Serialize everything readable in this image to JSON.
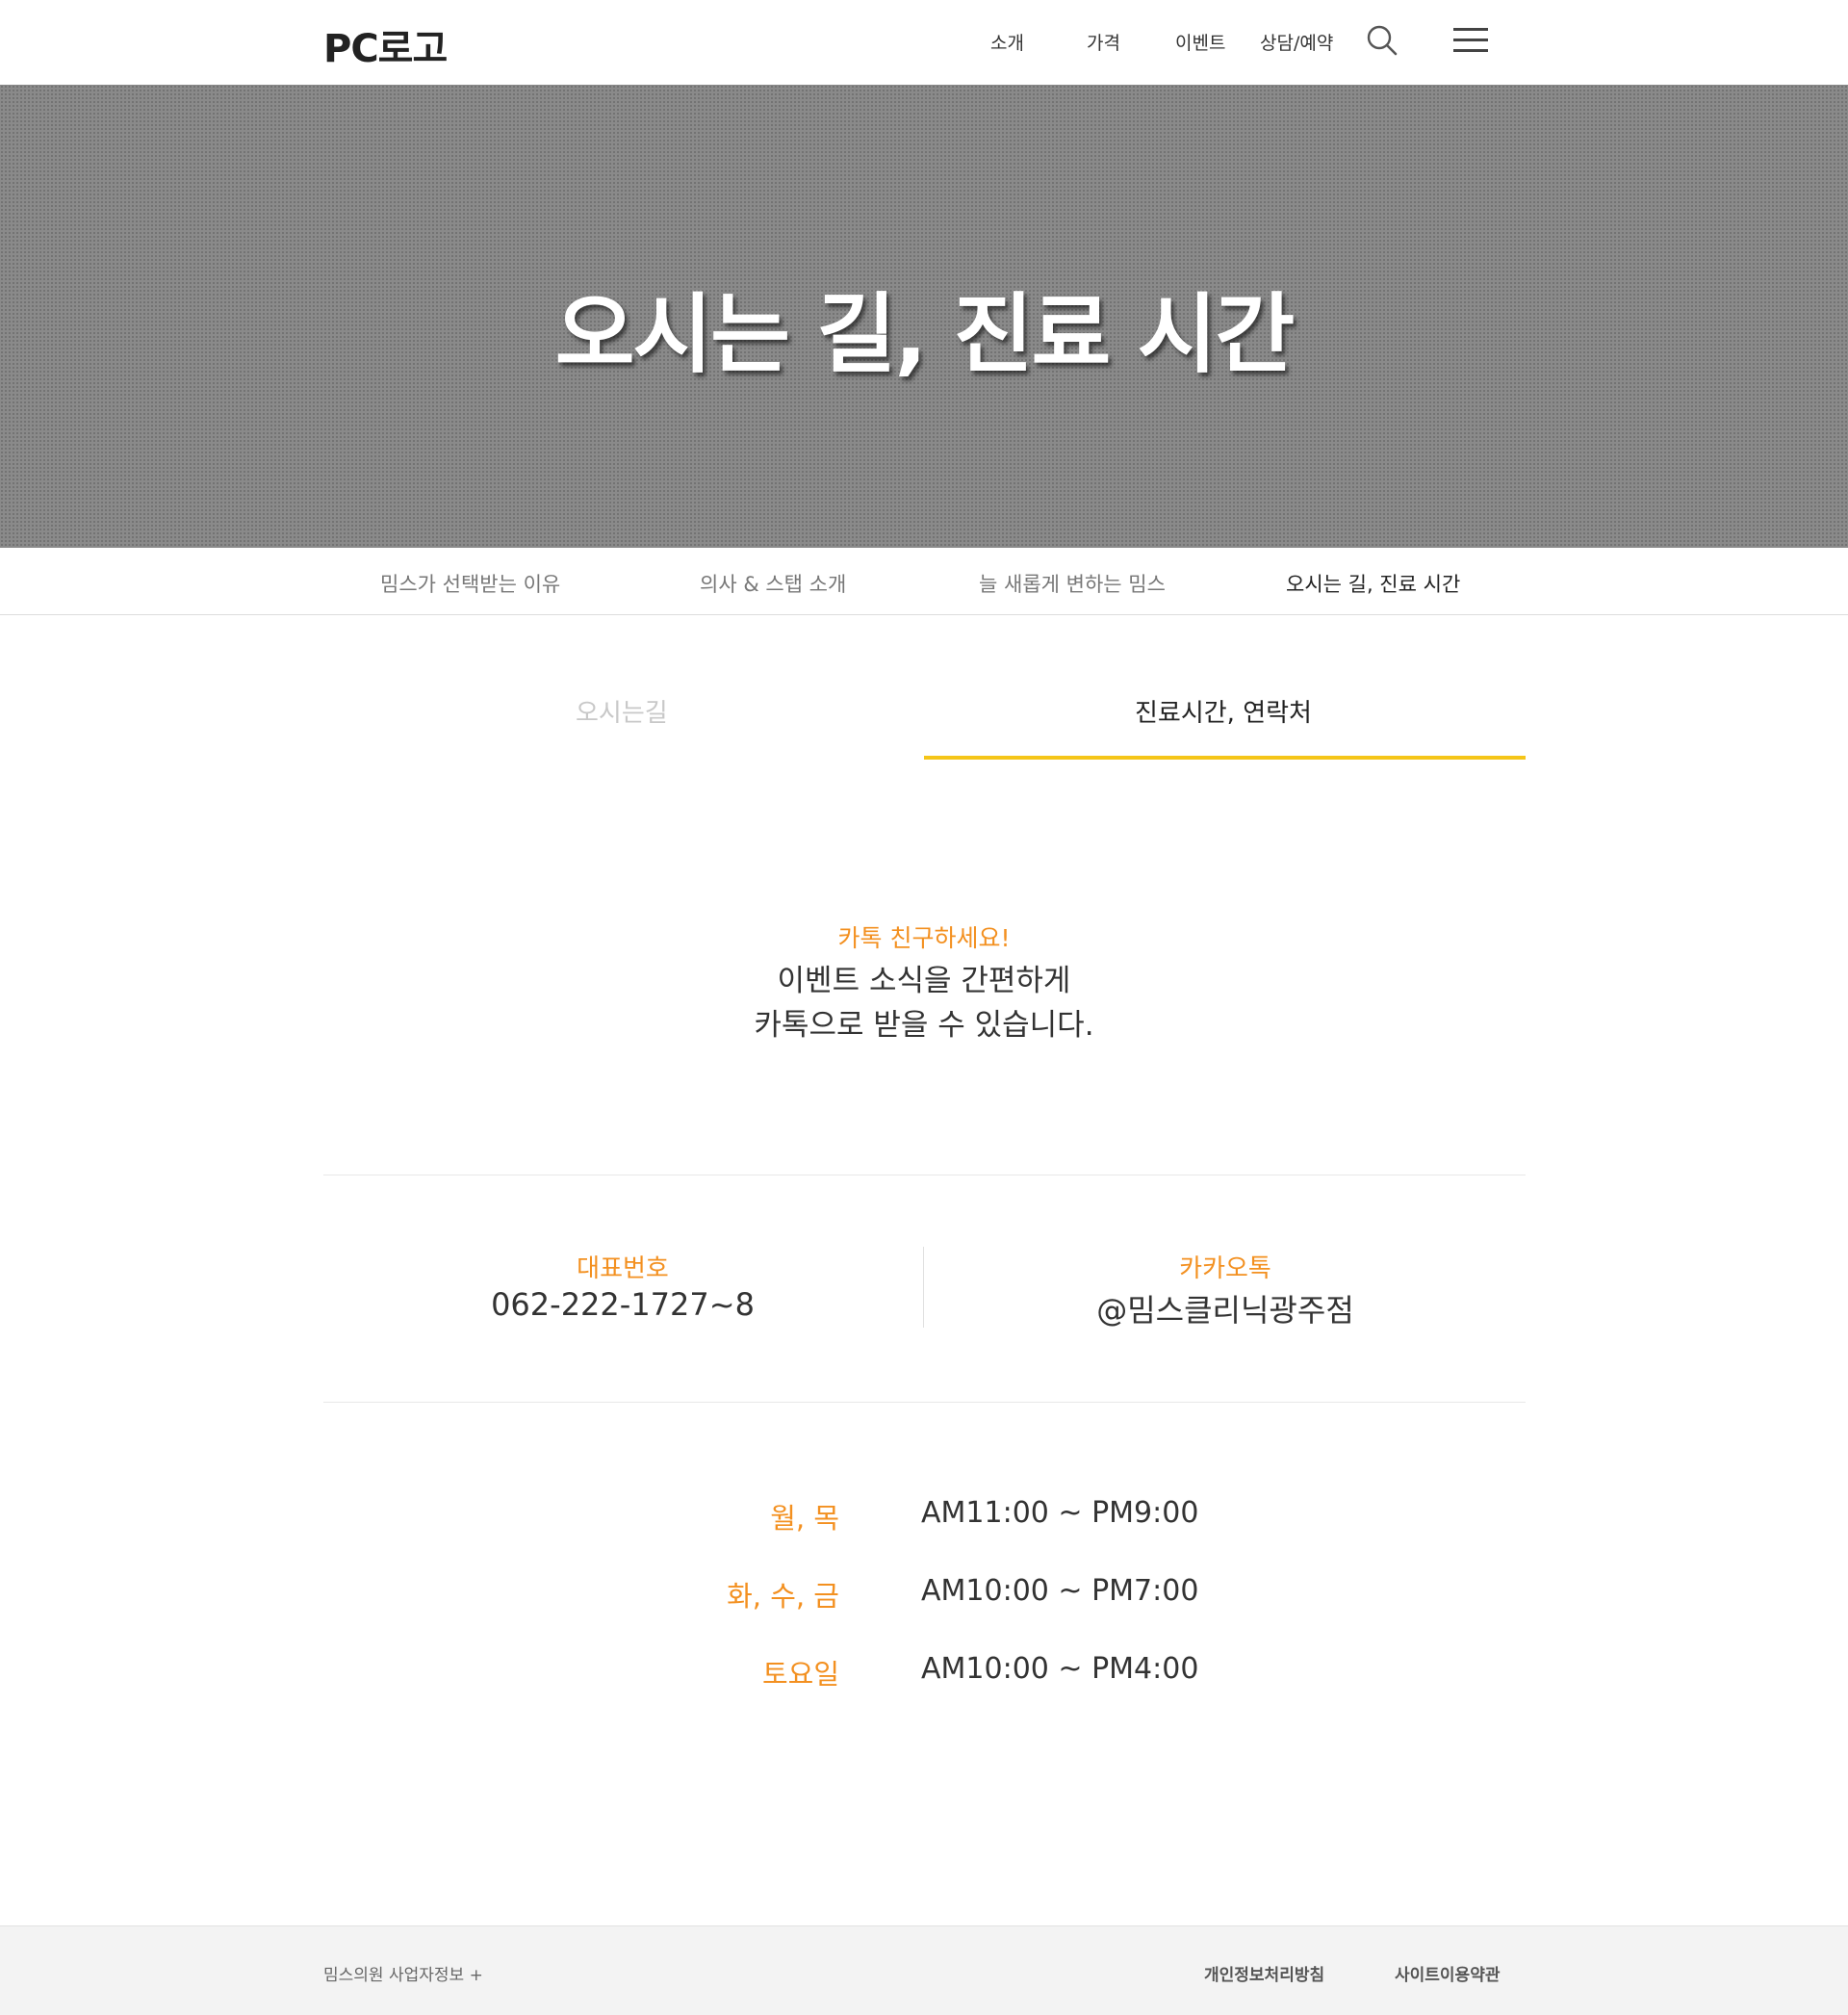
{
  "header": {
    "logo": "PC로고",
    "nav": [
      "소개",
      "가격",
      "이벤트",
      "상담/예약"
    ]
  },
  "hero": {
    "title": "오시는 길, 진료 시간"
  },
  "subnav": {
    "items": [
      "밈스가 선택받는 이유",
      "의사 & 스탭 소개",
      "늘 새롭게 변하는 밈스",
      "오시는 길, 진료 시간"
    ],
    "active_index": 3
  },
  "tabs": {
    "items": [
      "오시는길",
      "진료시간, 연락처"
    ],
    "active_index": 1
  },
  "promo": {
    "heading": "카톡 친구하세요!",
    "line1": "이벤트 소식을 간편하게",
    "line2": "카톡으로 받을 수 있습니다."
  },
  "contacts": {
    "phone_label": "대표번호",
    "phone_value": "062-222-1727~8",
    "kakao_label": "카카오톡",
    "kakao_value": "@밈스클리닉광주점"
  },
  "hours": [
    {
      "day": "월, 목",
      "time": "AM11:00 ~ PM9:00"
    },
    {
      "day": "화, 수, 금",
      "time": "AM10:00 ~ PM7:00"
    },
    {
      "day": "토요일",
      "time": "AM10:00 ~ PM4:00"
    }
  ],
  "footer": {
    "business_info": "밈스의원 사업자정보 +",
    "privacy": "개인정보처리방침",
    "terms": "사이트이용약관"
  },
  "colors": {
    "accent_orange": "#f39020",
    "tab_underline": "#f5c518",
    "hero_bg": "#8a8a8a"
  },
  "icons": [
    "search-icon",
    "hamburger-menu-icon"
  ]
}
